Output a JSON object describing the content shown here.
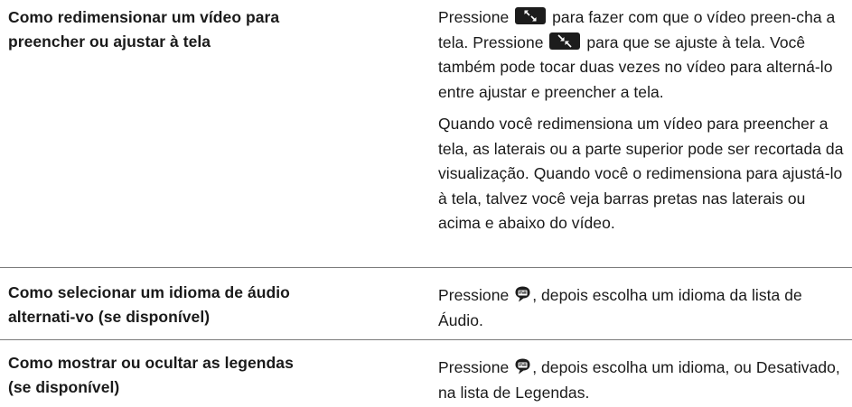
{
  "rows": [
    {
      "left": "Como redimensionar um vídeo para preencher ou ajustar à tela",
      "right_p1_a": "Pressione",
      "right_p1_b": "para fazer com que o vídeo preen-cha a tela. Pressione",
      "right_p1_c": "para que se ajuste à tela. Você também pode tocar duas vezes no vídeo para alterná-lo entre ajustar e preencher a tela.",
      "right_p2": "Quando você redimensiona um vídeo para preencher a tela, as laterais ou a parte superior pode ser recortada da visualização. Quando você o redimensiona para ajustá-lo à tela, talvez você veja barras pretas nas laterais ou acima e abaixo do vídeo."
    },
    {
      "left": "Como selecionar um idioma de áudio alternati-vo (se disponível)",
      "right_a": "Pressione",
      "right_b": ", depois escolha um idioma da lista de Áudio."
    },
    {
      "left": "Como mostrar ou ocultar as legendas (se disponível)",
      "right_a": "Pressione",
      "right_b": ", depois escolha um idioma, ou Desativado, na lista de Legendas."
    }
  ],
  "icons": {
    "fill": "fill-screen-icon",
    "fit": "fit-screen-icon",
    "subtitles": "subtitles-speech-bubble-icon"
  },
  "colors": {
    "text": "#1a1a1a",
    "divider": "#7a7a7a",
    "icon_bg": "#1c1c1c"
  }
}
